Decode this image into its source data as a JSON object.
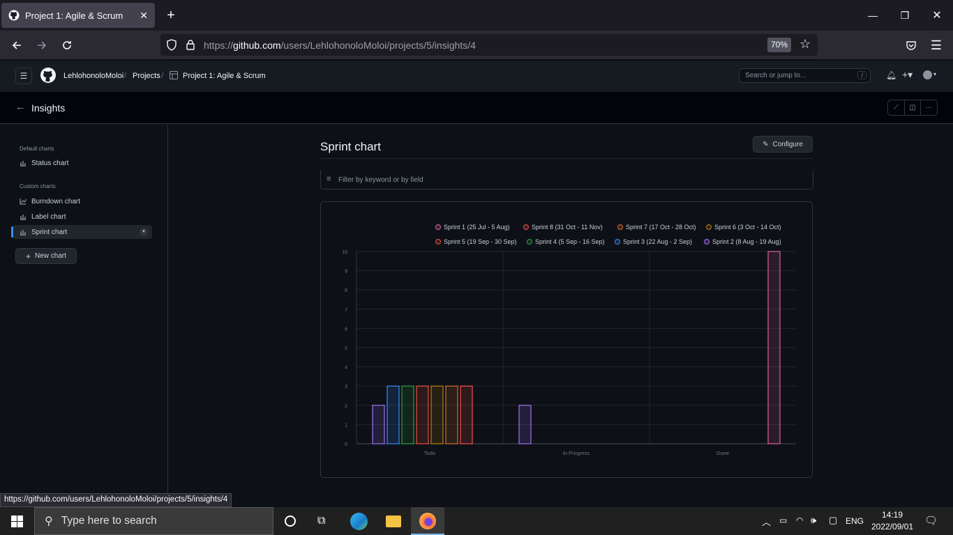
{
  "browser": {
    "tab_title": "Project 1: Agile & Scrum",
    "url_prefix": "https://",
    "url_domain": "github.com",
    "url_path": "/users/LehlohonoloMoloi/projects/5/insights/4",
    "zoom": "70%"
  },
  "github": {
    "breadcrumb": [
      "LehlohonoloMoloi",
      "Projects",
      "Project 1: Agile & Scrum"
    ],
    "search_placeholder": "Search or jump to...",
    "search_key": "/",
    "page_title": "Insights"
  },
  "sidebar": {
    "default_group": "Default charts",
    "default_items": [
      "Status chart"
    ],
    "custom_group": "Custom charts",
    "custom_items": [
      "Burndown chart",
      "Label chart",
      "Sprint chart"
    ],
    "new_chart_label": "New chart"
  },
  "main": {
    "chart_title": "Sprint chart",
    "configure_label": "Configure",
    "filter_placeholder": "Filter by keyword or by field"
  },
  "chart_data": {
    "type": "bar",
    "categories": [
      "Todo",
      "In Progress",
      "Done"
    ],
    "ylim": [
      0,
      10
    ],
    "yticks": [
      0,
      1,
      2,
      3,
      4,
      5,
      6,
      7,
      8,
      9,
      10
    ],
    "series": [
      {
        "name": "Sprint 1 (25 Jul - 5 Aug)",
        "color": "#db61a2",
        "values": [
          0,
          0,
          10
        ]
      },
      {
        "name": "Sprint 8 (31 Oct - 11 Nov)",
        "color": "#f85149",
        "values": [
          3,
          0,
          0
        ]
      },
      {
        "name": "Sprint 7 (17 Oct - 28 Oct)",
        "color": "#db6d28",
        "values": [
          3,
          0,
          0
        ]
      },
      {
        "name": "Sprint 6 (3 Oct - 14 Oct)",
        "color": "#bb8009",
        "values": [
          3,
          0,
          0
        ]
      },
      {
        "name": "Sprint 5 (19 Sep - 30 Sep)",
        "color": "#e8533e",
        "values": [
          3,
          0,
          0
        ]
      },
      {
        "name": "Sprint 4 (5 Sep - 16 Sep)",
        "color": "#2ea043",
        "values": [
          3,
          0,
          0
        ]
      },
      {
        "name": "Sprint 3 (22 Aug - 2 Sep)",
        "color": "#388bfd",
        "values": [
          3,
          0,
          0
        ]
      },
      {
        "name": "Sprint 2 (8 Aug - 19 Aug)",
        "color": "#a371f7",
        "values": [
          2,
          2,
          0
        ]
      }
    ]
  },
  "status_url": "https://github.com/users/LehlohonoloMoloi/projects/5/insights/4",
  "taskbar": {
    "search_placeholder": "Type here to search",
    "language": "ENG",
    "time": "14:19",
    "date": "2022/09/01"
  }
}
